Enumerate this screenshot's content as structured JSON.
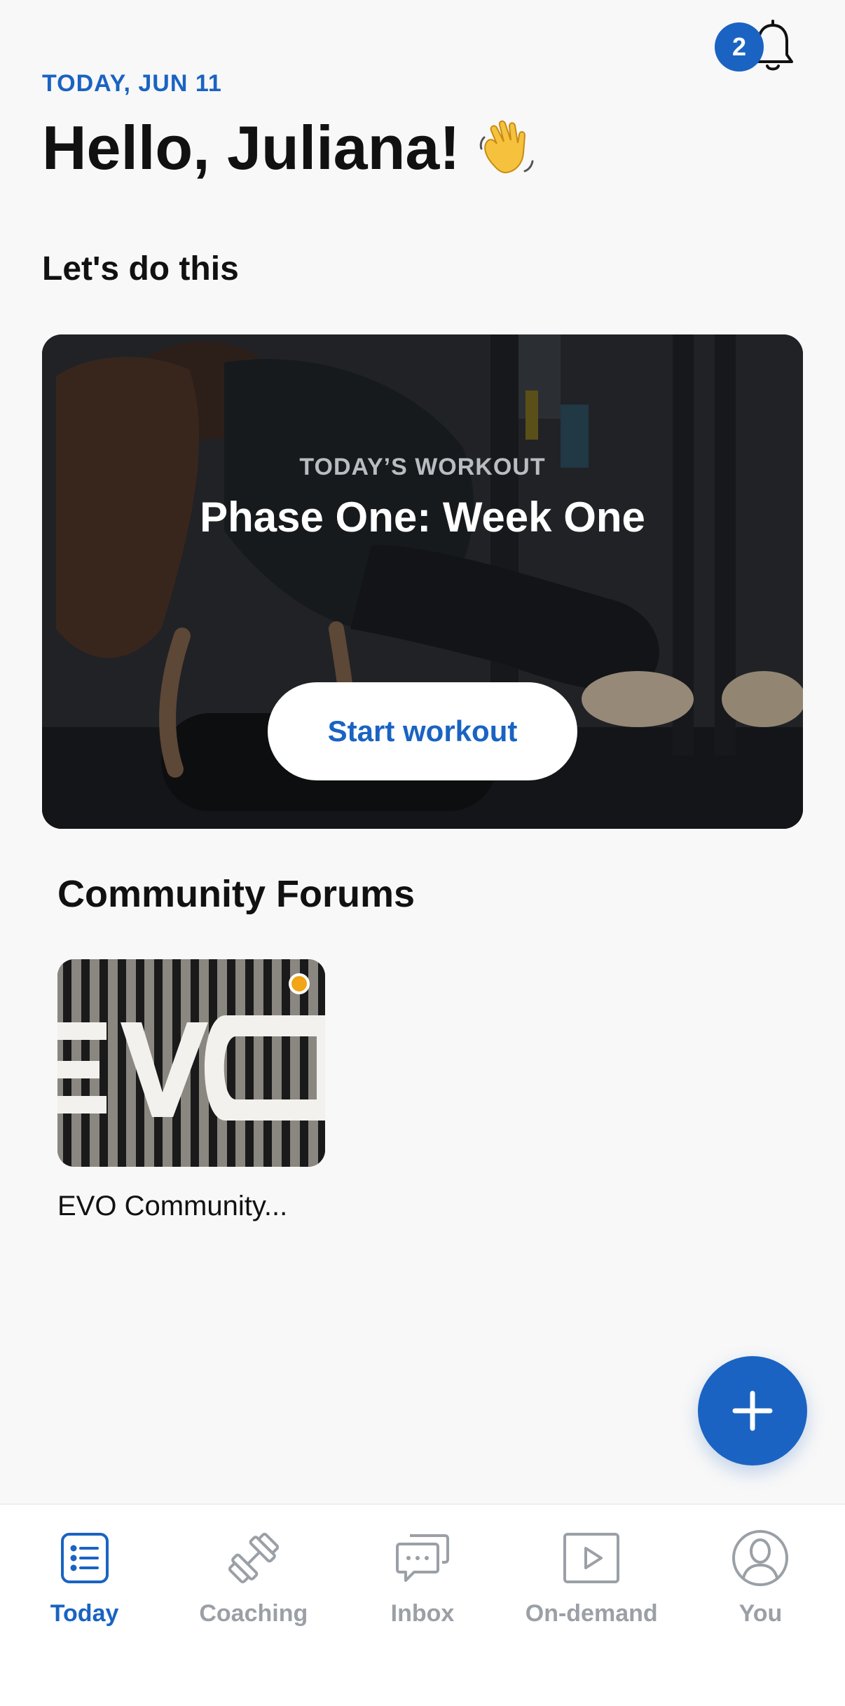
{
  "header": {
    "notification_count": "2",
    "date": "TODAY, JUN 11",
    "greeting": "Hello, Juliana!",
    "wave_emoji_icon": "waving-hand-icon"
  },
  "section": {
    "title": "Let's do this"
  },
  "workout": {
    "eyebrow": "TODAY’S WORKOUT",
    "title": "Phase One: Week One",
    "start_label": "Start workout"
  },
  "community": {
    "title": "Community Forums",
    "forums": [
      {
        "name": "EVO Community..."
      }
    ]
  },
  "nav": {
    "items": [
      {
        "label": "Today",
        "icon": "list-icon",
        "active": true
      },
      {
        "label": "Coaching",
        "icon": "dumbbell-icon",
        "active": false
      },
      {
        "label": "Inbox",
        "icon": "chat-icon",
        "active": false
      },
      {
        "label": "On-demand",
        "icon": "play-icon",
        "active": false
      },
      {
        "label": "You",
        "icon": "user-icon",
        "active": false
      }
    ]
  },
  "colors": {
    "accent": "#1a63c2",
    "badge": "#1a63c2",
    "unread_dot": "#f2a516",
    "background": "#f8f8f8"
  }
}
